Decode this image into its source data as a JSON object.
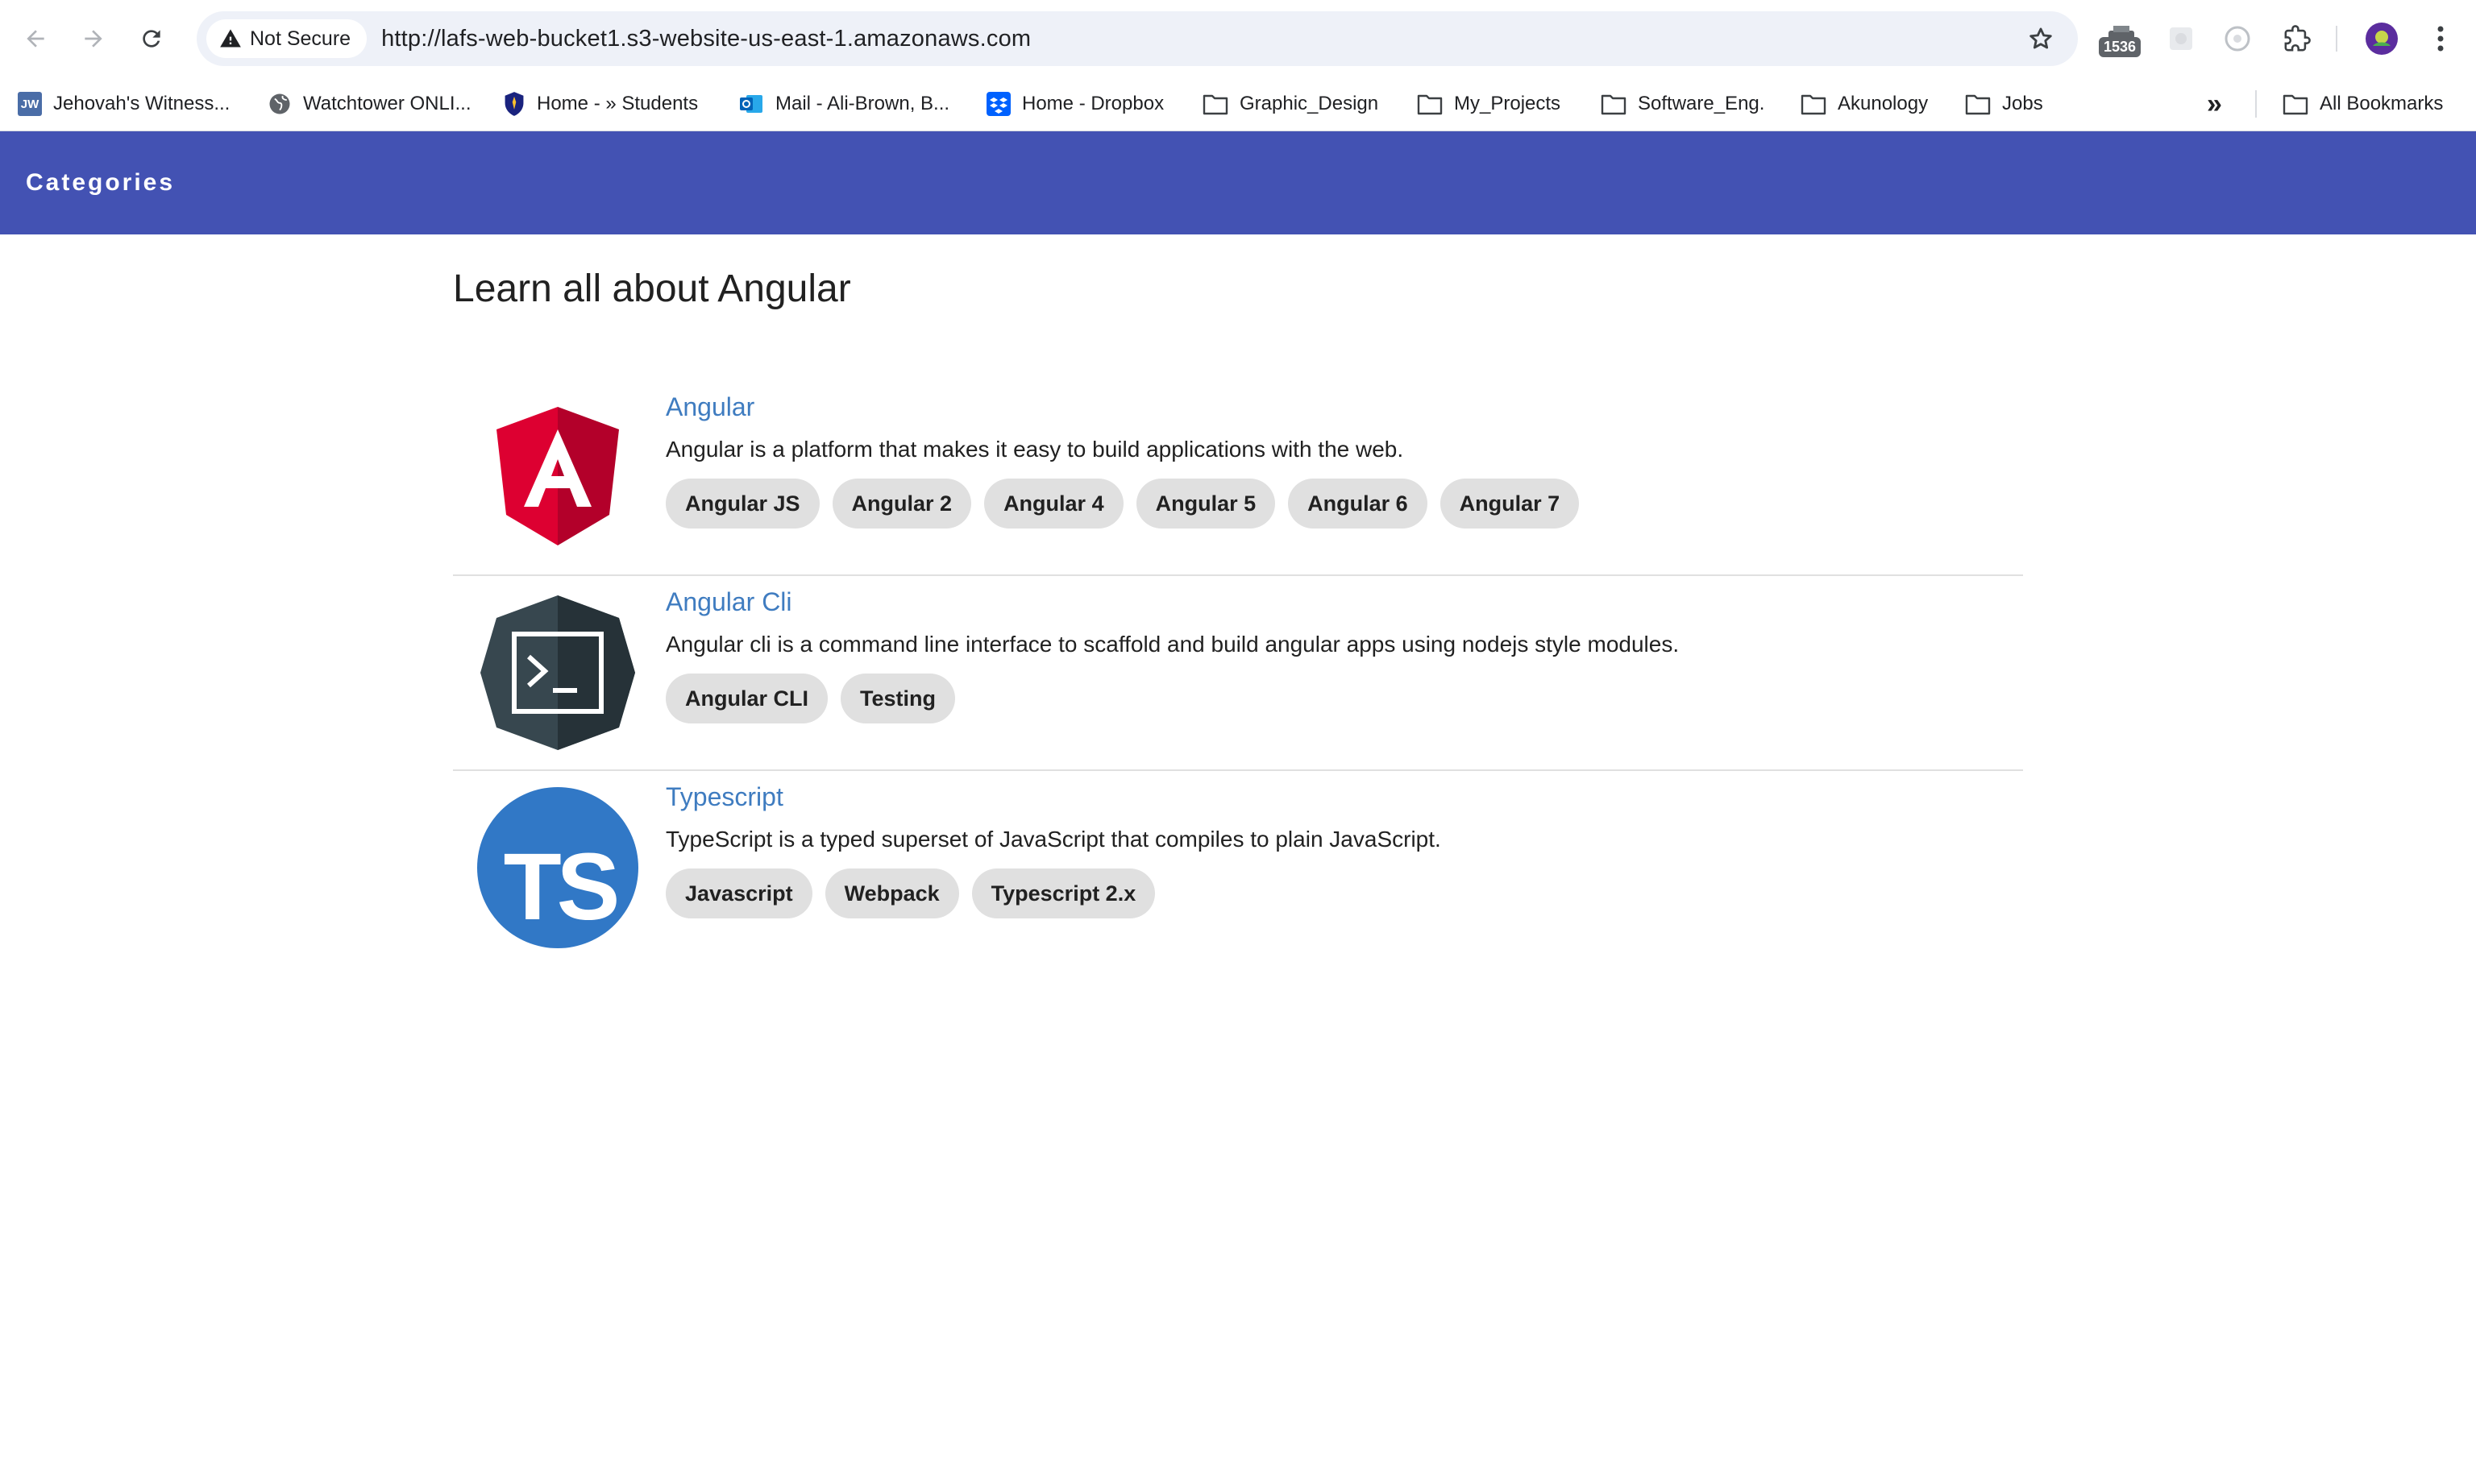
{
  "browser": {
    "security_label": "Not Secure",
    "url": "http://lafs-web-bucket1.s3-website-us-east-1.amazonaws.com",
    "extension_badge": "1536",
    "icons": {
      "back": "arrow-left-icon",
      "forward": "arrow-right-icon",
      "reload": "reload-icon",
      "warning": "warning-triangle-icon",
      "star": "star-icon",
      "extensions": "puzzle-icon",
      "menu": "kebab-menu-icon"
    }
  },
  "bookmarks": {
    "items": [
      {
        "label": "Jehovah's Witness...",
        "icon": "jw-icon"
      },
      {
        "label": "Watchtower ONLI...",
        "icon": "globe-icon"
      },
      {
        "label": "Home - » Students",
        "icon": "shield-icon"
      },
      {
        "label": "Mail - Ali-Brown, B...",
        "icon": "outlook-icon"
      },
      {
        "label": "Home - Dropbox",
        "icon": "dropbox-icon"
      },
      {
        "label": "Graphic_Design",
        "icon": "folder-icon"
      },
      {
        "label": "My_Projects",
        "icon": "folder-icon"
      },
      {
        "label": "Software_Eng.",
        "icon": "folder-icon"
      },
      {
        "label": "Akunology",
        "icon": "folder-icon"
      },
      {
        "label": "Jobs",
        "icon": "folder-icon"
      }
    ],
    "overflow": "»",
    "all_bookmarks": "All Bookmarks",
    "jw_badge_text": "JW"
  },
  "header": {
    "brand": "Categories",
    "color": "#4352b3"
  },
  "main": {
    "title": "Learn all about Angular",
    "categories": [
      {
        "name": "Angular",
        "description": "Angular is a platform that makes it easy to build applications with the web.",
        "tags": [
          "Angular JS",
          "Angular 2",
          "Angular 4",
          "Angular 5",
          "Angular 6",
          "Angular 7"
        ],
        "logo": "angular-logo-icon"
      },
      {
        "name": "Angular Cli",
        "description": "Angular cli is a command line interface to scaffold and build angular apps using nodejs style modules.",
        "tags": [
          "Angular CLI",
          "Testing"
        ],
        "logo": "terminal-logo-icon"
      },
      {
        "name": "Typescript",
        "description": "TypeScript is a typed superset of JavaScript that compiles to plain JavaScript.",
        "tags": [
          "Javascript",
          "Webpack",
          "Typescript 2.x"
        ],
        "logo": "typescript-logo-icon",
        "logo_text": "TS"
      }
    ]
  },
  "colors": {
    "link": "#3f7cc0",
    "chip": "#e0e0e0",
    "angular_red": "#dd0031",
    "ts_blue": "#3178c6"
  }
}
